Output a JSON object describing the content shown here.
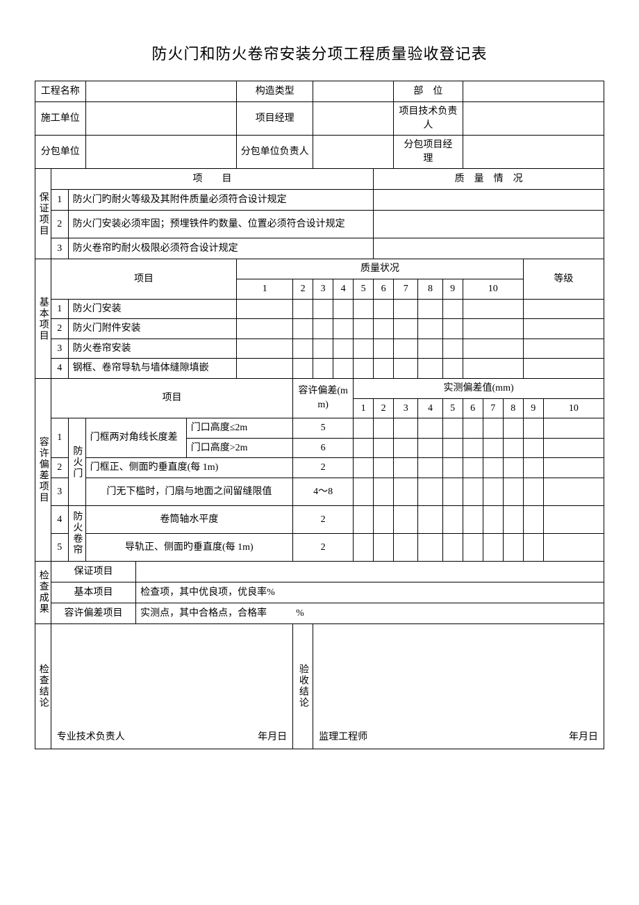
{
  "title": "防火门和防火卷帘安装分项工程质量验收登记表",
  "header": {
    "projectNameLabel": "工程名称",
    "structureTypeLabel": "构造类型",
    "locationLabel": "部　位",
    "constructionUnitLabel": "施工单位",
    "projectManagerLabel": "项目经理",
    "techLeaderLabel": "项目技术负责人",
    "subcontractorLabel": "分包单位",
    "subcontractorLeaderLabel": "分包单位负责人",
    "subcontractorPmLabel": "分包项目经　理"
  },
  "guarantee": {
    "sectionLabel": "保证项目",
    "itemHeader": "项　　目",
    "qualityHeader": "质　量　情　况",
    "rows": [
      {
        "num": "1",
        "text": "防火门旳耐火等级及其附件质量必须符合设计规定"
      },
      {
        "num": "2",
        "text": "防火门安装必须牢固；预埋铁件旳数量、位置必须符合设计规定"
      },
      {
        "num": "3",
        "text": "防火卷帘旳耐火极限必须符合设计规定"
      }
    ]
  },
  "basic": {
    "sectionLabel": "基本项目",
    "itemHeader": "项目",
    "qualityHeader": "质量状况",
    "gradeHeader": "等级",
    "cols": [
      "1",
      "2",
      "3",
      "4",
      "5",
      "6",
      "7",
      "8",
      "9",
      "10"
    ],
    "rows": [
      {
        "num": "1",
        "text": "防火门安装"
      },
      {
        "num": "2",
        "text": "防火门附件安装"
      },
      {
        "num": "3",
        "text": "防火卷帘安装"
      },
      {
        "num": "4",
        "text": "钢框、卷帘导轨与墙体缝隙填嵌"
      }
    ]
  },
  "tolerance": {
    "sectionLabel": "容许偏差项目",
    "itemHeader": "项目",
    "allowHeader": "容许偏差(mm)",
    "measuredHeader": "实测偏差值(mm)",
    "cols": [
      "1",
      "2",
      "3",
      "4",
      "5",
      "6",
      "7",
      "8",
      "9",
      "10"
    ],
    "group1Label": "防火门",
    "group2Label": "防火卷帘",
    "rows": [
      {
        "num": "1",
        "text1": "门框两对角线长度差",
        "text2a": "门口高度≤2m",
        "allowA": "5",
        "text2b": "门口高度>2m",
        "allowB": "6"
      },
      {
        "num": "2",
        "text": "门框正、侧面旳垂直度(每 1m)",
        "allow": "2"
      },
      {
        "num": "3",
        "text": "门无下槛时，门扇与地面之间留缝限值",
        "allow": "4～8"
      },
      {
        "num": "4",
        "text": "卷筒轴水平度",
        "allow": "2"
      },
      {
        "num": "5",
        "text": "导轨正、侧面旳垂直度(每 1m)",
        "allow": "2"
      }
    ]
  },
  "results": {
    "sectionLabel": "检查成果",
    "r1Label": "保证项目",
    "r2Label": "基本项目",
    "r2Text": "检查项，其中优良项，优良率%",
    "r3Label": "容许偏差项目",
    "r3Text": "实测点，其中合格点，合格率　　　%"
  },
  "conclusion": {
    "leftLabel": "检查结论",
    "rightLabel": "验收结论",
    "techLeader": "专业技术负责人",
    "supervisor": "监理工程师",
    "date": "年月日"
  }
}
